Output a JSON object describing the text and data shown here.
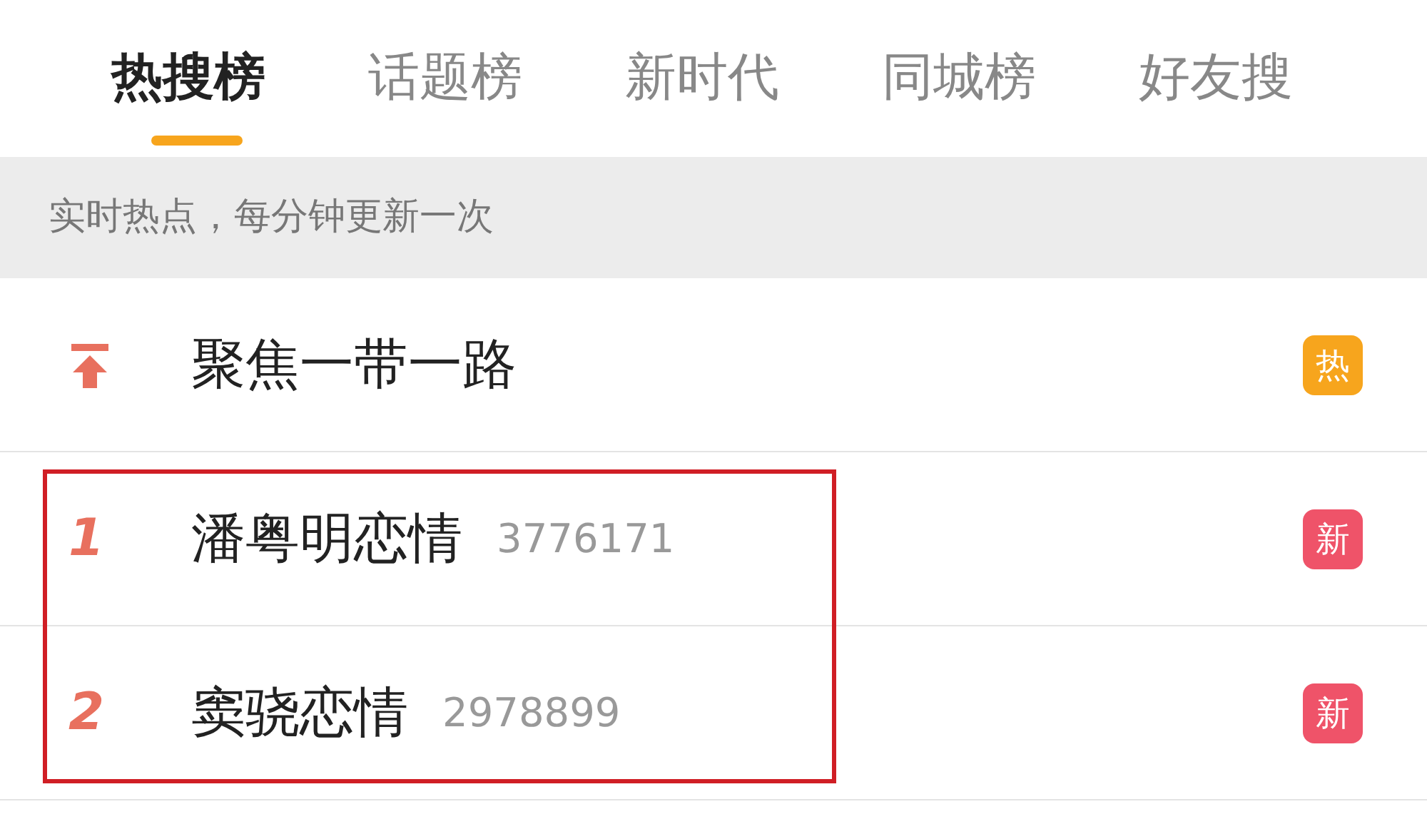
{
  "tabs": [
    {
      "label": "热搜榜",
      "selected": true
    },
    {
      "label": "话题榜",
      "selected": false
    },
    {
      "label": "新时代",
      "selected": false
    },
    {
      "label": "同城榜",
      "selected": false
    },
    {
      "label": "好友搜",
      "selected": false
    }
  ],
  "notice": "实时热点，每分钟更新一次",
  "items": [
    {
      "kind": "pinned",
      "title": "聚焦一带一路",
      "badge": "热",
      "color": "#f7a51d",
      "highlighted": false
    },
    {
      "kind": "ranked",
      "rank": "1",
      "title": "潘粤明恋情",
      "count": "3776171",
      "badge": "新",
      "color": "#ef5369",
      "highlighted": true
    },
    {
      "kind": "ranked",
      "rank": "2",
      "title": "窦骁恋情",
      "count": "2978899",
      "badge": "新",
      "color": "#ef5369",
      "highlighted": true
    }
  ]
}
